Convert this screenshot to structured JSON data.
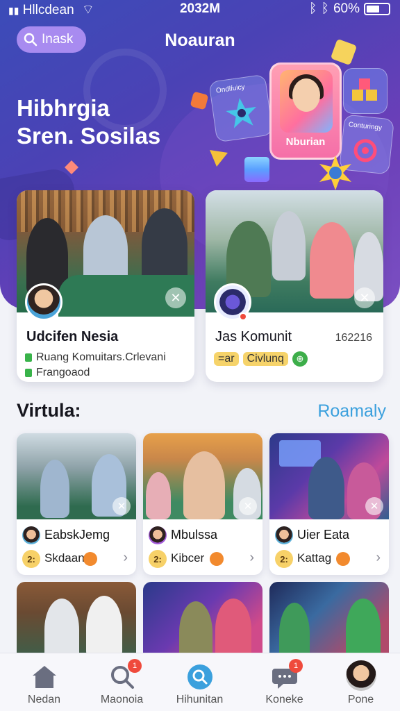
{
  "status": {
    "carrier": "Hllcdean",
    "time": "2032M",
    "battery": "60%",
    "battery_level": 0.6
  },
  "header": {
    "search_label": "Inask",
    "title": "Noauran"
  },
  "hero": {
    "title_line1": "Hibhrgia",
    "title_line2": "Sren. Sosilas",
    "card1_label": "Ondifuicy",
    "card2_label": "Conturingy",
    "profile_label": "Nburian"
  },
  "featured": [
    {
      "name": "Udcifen Nesia",
      "line1": "Ruang Komuitars.Crlevani",
      "line2": "Frangoaod"
    },
    {
      "name": "Jas Komunit",
      "count": "162216",
      "tag1": "=ar",
      "tag2": "Civlunq",
      "icon_text": "⊕"
    }
  ],
  "section": {
    "title": "Virtula:",
    "link": "Roamaly"
  },
  "grid": [
    {
      "name": "EabskJemg",
      "label": "Skdaan",
      "smile": "2:"
    },
    {
      "name": "Mbulssa",
      "label": "Kibcer",
      "smile": "2:"
    },
    {
      "name": "Uier Eata",
      "label": "Kattag",
      "smile": "2:"
    }
  ],
  "nav": [
    {
      "label": "Nedan",
      "icon": "home-icon"
    },
    {
      "label": "Maonoia",
      "icon": "search-icon",
      "badge": "1"
    },
    {
      "label": "Hihunitan",
      "icon": "search-circle-icon"
    },
    {
      "label": "Koneke",
      "icon": "chat-icon",
      "badge": "1"
    },
    {
      "label": "Pone",
      "icon": "profile-avatar"
    }
  ],
  "colors": {
    "accent": "#3ba0dd",
    "hero_start": "#3b4cb8",
    "hero_end": "#7b4fc2",
    "pill": "#a88bf0"
  }
}
